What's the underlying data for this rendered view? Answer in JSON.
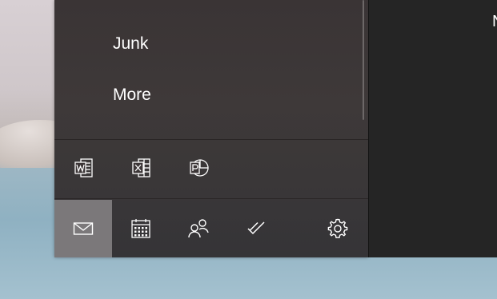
{
  "folders": [
    {
      "label": "Junk"
    },
    {
      "label": "More"
    }
  ],
  "apps": [
    {
      "icon": "word-icon"
    },
    {
      "icon": "excel-icon"
    },
    {
      "icon": "powerpoint-icon"
    }
  ],
  "nav": [
    {
      "icon": "mail-icon",
      "active": true
    },
    {
      "icon": "calendar-icon",
      "active": false
    },
    {
      "icon": "people-icon",
      "active": false
    },
    {
      "icon": "todo-check-icon",
      "active": false
    },
    {
      "icon": "gear-icon",
      "active": false
    }
  ],
  "content": {
    "partial_text": "N"
  },
  "colors": {
    "pane_bg": "#3c3637",
    "content_bg": "#252525",
    "active_nav": "#7b787a",
    "text": "#ffffff"
  }
}
